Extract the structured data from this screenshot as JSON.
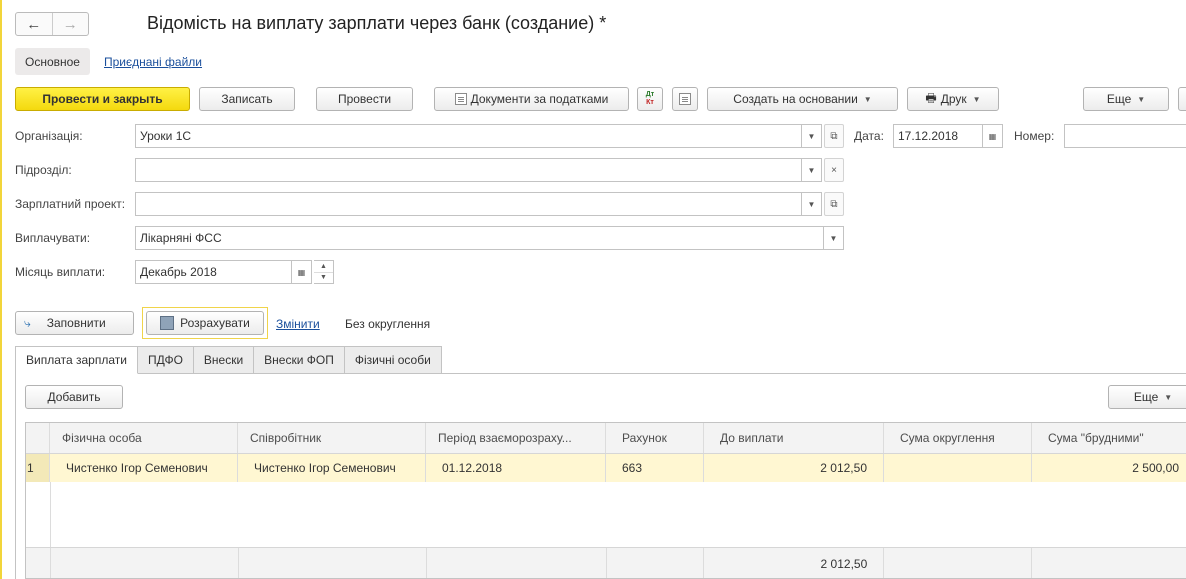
{
  "window": {
    "title": "Відомість на виплату зарплати через банк (создание) *"
  },
  "nav": {
    "back_glyph": "←",
    "forward_glyph": "→"
  },
  "section_tabs": {
    "main": "Основное",
    "files": "Приєднані файли"
  },
  "toolbar": {
    "post_close": "Провести и закрыть",
    "write": "Записать",
    "post": "Провести",
    "tax_docs": "Документи за податками",
    "dtkt_top": "Дт",
    "dtkt_bottom": "Кт",
    "create_based": "Создать на основании",
    "print": "Друк",
    "more": "Еще"
  },
  "form": {
    "org_label": "Організація:",
    "org_value": "Уроки 1С",
    "date_label": "Дата:",
    "date_value": "17.12.2018",
    "number_label": "Номер:",
    "number_value": "",
    "dept_label": "Підрозділ:",
    "dept_value": "",
    "salary_project_label": "Зарплатний проект:",
    "salary_project_value": "",
    "pay_label": "Виплачувати:",
    "pay_value": "Лікарняні ФСС",
    "month_label": "Місяць виплати:",
    "month_value": "Декабрь 2018"
  },
  "actions": {
    "fill": "Заповнити",
    "calculate": "Розрахувати",
    "change": "Змінити",
    "rounding": "Без округлення"
  },
  "tabs": [
    "Виплата зарплати",
    "ПДФО",
    "Внески",
    "Внески ФОП",
    "Фізичні особи"
  ],
  "table_toolbar": {
    "add": "Добавить",
    "more": "Еще"
  },
  "table": {
    "columns": [
      "",
      "Фізична особа",
      "Співробітник",
      "Період взаєморозраху...",
      "Рахунок",
      "До виплати",
      "Сума округлення",
      "Сума \"брудними\""
    ],
    "rows": [
      [
        "1",
        "Чистенко Ігор Семенович",
        "Чистенко Ігор Семенович",
        "01.12.2018",
        "663",
        "2 012,50",
        "",
        "2 500,00"
      ]
    ],
    "footer": [
      "",
      "",
      "",
      "",
      "",
      "2 012,50",
      "",
      ""
    ]
  },
  "colors": {
    "accent_yellow": "#f4d90e",
    "selected_row": "#fff7d2",
    "link": "#1a4f9c"
  }
}
